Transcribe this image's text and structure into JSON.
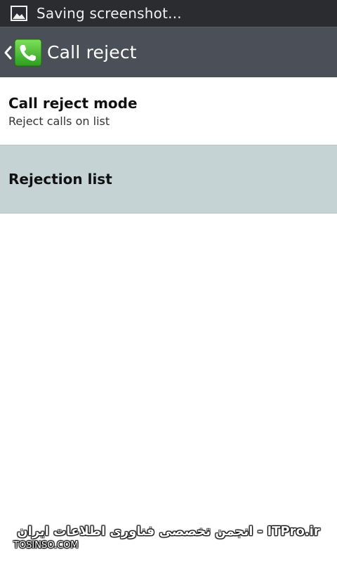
{
  "status_bar": {
    "notification_icon": "image-icon",
    "text": "Saving screenshot..."
  },
  "action_bar": {
    "back_icon": "chevron-left-icon",
    "app_icon": "phone-icon",
    "title": "Call reject",
    "background_color": "#4b4f58"
  },
  "list": {
    "items": [
      {
        "title": "Call reject mode",
        "summary": "Reject calls on list"
      },
      {
        "title": "Rejection list",
        "selected": true
      }
    ],
    "selected_color": "#c5d3d5"
  },
  "watermark": {
    "main": "ITPro.ir - انجمن تخصصی فناوری اطلاعات ایران",
    "sub": "TOSINSO.COM"
  }
}
